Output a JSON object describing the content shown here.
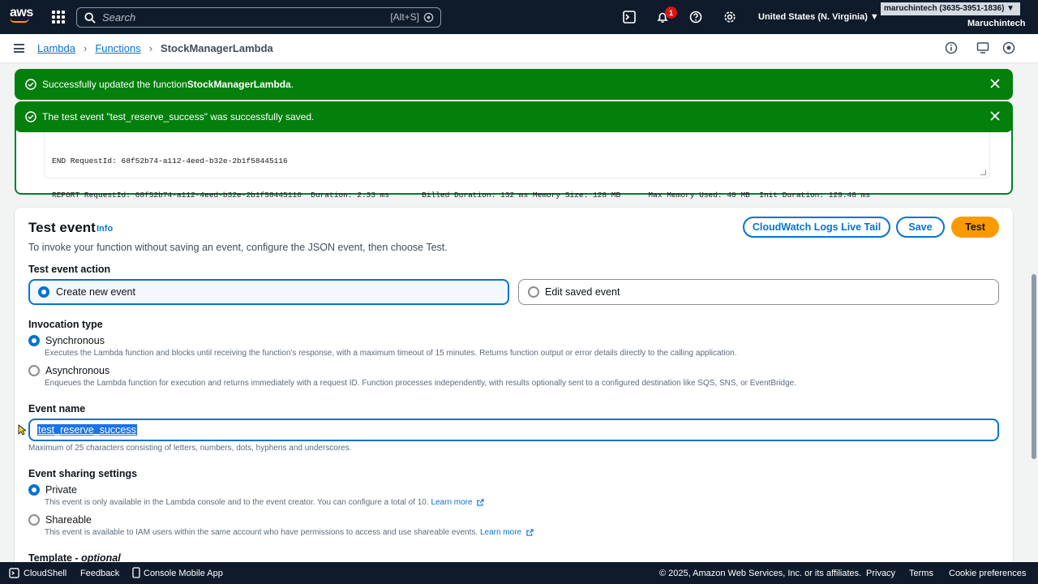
{
  "topnav": {
    "logo": "aws",
    "search_placeholder": "Search",
    "search_shortcut": "[Alt+S]",
    "notifications_count": "1",
    "region": "United States (N. Virginia) ▼",
    "account": "maruchintech (3635-3951-1836) ▼",
    "account_name": "Maruchintech"
  },
  "breadcrumb": {
    "items": [
      "Lambda",
      "Functions"
    ],
    "current": "StockManagerLambda"
  },
  "flashes": [
    {
      "text_prefix": "Successfully updated the function ",
      "text_bold": "StockManagerLambda",
      "text_suffix": "."
    },
    {
      "text_prefix": "The test event \"test_reserve_success\" was successfully saved.",
      "text_bold": "",
      "text_suffix": ""
    }
  ],
  "log": {
    "line1": "END RequestId: 68f52b74-a112-4eed-b32e-2b1f58445116",
    "line2": "REPORT RequestId: 68f52b74-a112-4eed-b32e-2b1f58445116  Duration: 2.33 ms       Billed Duration: 132 ms Memory Size: 128 MB      Max Memory Used: 40 MB  Init Duration: 129.48 ms"
  },
  "test_event": {
    "title": "Test event",
    "info": "Info",
    "description": "To invoke your function without saving an event, configure the JSON event, then choose Test.",
    "buttons": {
      "cloudwatch": "CloudWatch Logs Live Tail",
      "save": "Save",
      "test": "Test"
    },
    "action_label": "Test event action",
    "action_options": [
      "Create new event",
      "Edit saved event"
    ],
    "invocation_label": "Invocation type",
    "invocation_options": [
      {
        "label": "Synchronous",
        "desc": "Executes the Lambda function and blocks until receiving the function's response, with a maximum timeout of 15 minutes. Returns function output or error details directly to the calling application."
      },
      {
        "label": "Asynchronous",
        "desc": "Enqueues the Lambda function for execution and returns immediately with a request ID. Function processes independently, with results optionally sent to a configured destination like SQS, SNS, or EventBridge."
      }
    ],
    "event_name_label": "Event name",
    "event_name_value": "test_reserve_success",
    "event_name_hint": "Maximum of 25 characters consisting of letters, numbers, dots, hyphens and underscores.",
    "sharing_label": "Event sharing settings",
    "sharing_options": [
      {
        "label": "Private",
        "desc": "This event is only available in the Lambda console and to the event creator. You can configure a total of 10.",
        "link": "Learn more"
      },
      {
        "label": "Shareable",
        "desc": "This event is available to IAM users within the same account who have permissions to access and use shareable events.",
        "link": "Learn more"
      }
    ],
    "template_label": "Template - ",
    "template_optional": "optional"
  },
  "footer": {
    "cloudshell": "CloudShell",
    "feedback": "Feedback",
    "mobile": "Console Mobile App",
    "copyright": "© 2025, Amazon Web Services, Inc. or its affiliates.",
    "privacy": "Privacy",
    "terms": "Terms",
    "cookie": "Cookie preferences"
  },
  "colors": {
    "nav": "#0f1b2a",
    "success": "#037f0c",
    "link": "#0972d3",
    "primary": "#ff9900"
  }
}
